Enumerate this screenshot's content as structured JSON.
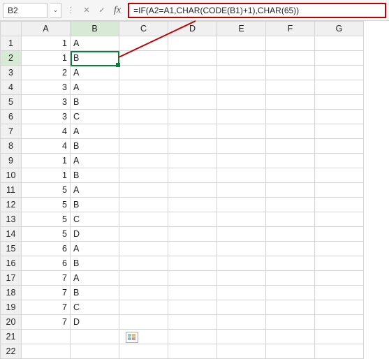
{
  "namebox": {
    "value": "B2"
  },
  "formula_bar": {
    "formula": "=IF(A2=A1,CHAR(CODE(B1)+1),CHAR(65))"
  },
  "columns": [
    "A",
    "B",
    "C",
    "D",
    "E",
    "F",
    "G"
  ],
  "rows": [
    "1",
    "2",
    "3",
    "4",
    "5",
    "6",
    "7",
    "8",
    "9",
    "10",
    "11",
    "12",
    "13",
    "14",
    "15",
    "16",
    "17",
    "18",
    "19",
    "20",
    "21",
    "22"
  ],
  "active_cell": {
    "col": "B",
    "row": "2"
  },
  "cells": {
    "A1": "1",
    "B1": "A",
    "A2": "1",
    "B2": "B",
    "A3": "2",
    "B3": "A",
    "A4": "3",
    "B4": "A",
    "A5": "3",
    "B5": "B",
    "A6": "3",
    "B6": "C",
    "A7": "4",
    "B7": "A",
    "A8": "4",
    "B8": "B",
    "A9": "1",
    "B9": "A",
    "A10": "1",
    "B10": "B",
    "A11": "5",
    "B11": "A",
    "A12": "5",
    "B12": "B",
    "A13": "5",
    "B13": "C",
    "A14": "5",
    "B14": "D",
    "A15": "6",
    "B15": "A",
    "A16": "6",
    "B16": "B",
    "A17": "7",
    "B17": "A",
    "A18": "7",
    "B18": "B",
    "A19": "7",
    "B19": "C",
    "A20": "7",
    "B20": "D"
  },
  "icons": {
    "cancel": "✕",
    "confirm": "✓",
    "dropdown": "⌄"
  },
  "chart_data": {
    "type": "table",
    "columns": [
      "A",
      "B"
    ],
    "rows": [
      [
        1,
        "A"
      ],
      [
        1,
        "B"
      ],
      [
        2,
        "A"
      ],
      [
        3,
        "A"
      ],
      [
        3,
        "B"
      ],
      [
        3,
        "C"
      ],
      [
        4,
        "A"
      ],
      [
        4,
        "B"
      ],
      [
        1,
        "A"
      ],
      [
        1,
        "B"
      ],
      [
        5,
        "A"
      ],
      [
        5,
        "B"
      ],
      [
        5,
        "C"
      ],
      [
        5,
        "D"
      ],
      [
        6,
        "A"
      ],
      [
        6,
        "B"
      ],
      [
        7,
        "A"
      ],
      [
        7,
        "B"
      ],
      [
        7,
        "C"
      ],
      [
        7,
        "D"
      ]
    ]
  }
}
